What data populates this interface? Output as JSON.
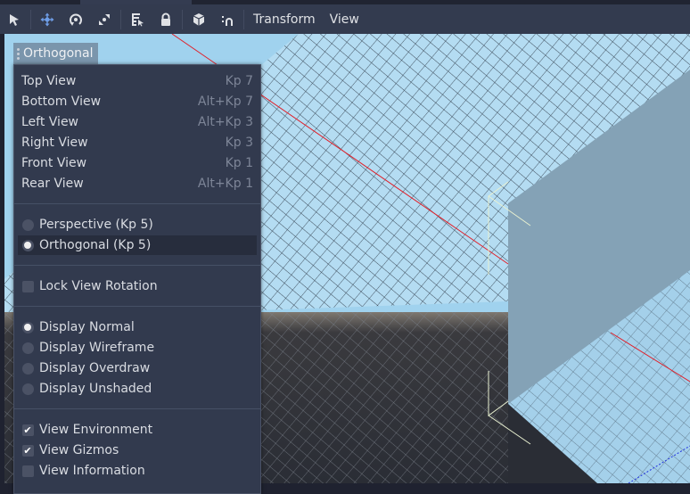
{
  "toolbar": {
    "tools": [
      {
        "name": "select-tool",
        "icon": "pointer-arrow-icon",
        "active": false
      },
      {
        "name": "move-tool",
        "icon": "move-arrows-icon",
        "active": true
      },
      {
        "name": "rotate-tool",
        "icon": "rotate-icon",
        "active": false
      },
      {
        "name": "scale-tool",
        "icon": "scale-icon",
        "active": false
      },
      {
        "name": "list-select-tool",
        "icon": "list-select-icon",
        "active": false
      },
      {
        "name": "lock-tool",
        "icon": "lock-icon",
        "active": false
      },
      {
        "name": "local-space-tool",
        "icon": "cube-icon",
        "active": false
      },
      {
        "name": "snap-tool",
        "icon": "snap-magnet-icon",
        "active": false
      }
    ],
    "menus": [
      "Transform",
      "View"
    ]
  },
  "viewport": {
    "view_button_label": "Orthogonal",
    "colors": {
      "sky": "#a0d2ee",
      "ground": "#2c2f38",
      "box": "#84a2b6",
      "x_axis": "#e0202a",
      "z_axis": "#2030e0"
    }
  },
  "view_menu": {
    "views": [
      {
        "label": "Top View",
        "shortcut": "Kp 7"
      },
      {
        "label": "Bottom View",
        "shortcut": "Alt+Kp 7"
      },
      {
        "label": "Left View",
        "shortcut": "Alt+Kp 3"
      },
      {
        "label": "Right View",
        "shortcut": "Kp 3"
      },
      {
        "label": "Front View",
        "shortcut": "Kp 1"
      },
      {
        "label": "Rear View",
        "shortcut": "Alt+Kp 1"
      }
    ],
    "projection": [
      {
        "label": "Perspective (Kp 5)",
        "checked": false
      },
      {
        "label": "Orthogonal (Kp 5)",
        "checked": true
      }
    ],
    "lock_rotation": {
      "label": "Lock View Rotation",
      "checked": false
    },
    "display_modes": [
      {
        "label": "Display Normal",
        "checked": true
      },
      {
        "label": "Display Wireframe",
        "checked": false
      },
      {
        "label": "Display Overdraw",
        "checked": false
      },
      {
        "label": "Display Unshaded",
        "checked": false
      }
    ],
    "view_toggles": [
      {
        "label": "View Environment",
        "checked": true
      },
      {
        "label": "View Gizmos",
        "checked": true
      },
      {
        "label": "View Information",
        "checked": false
      }
    ]
  }
}
